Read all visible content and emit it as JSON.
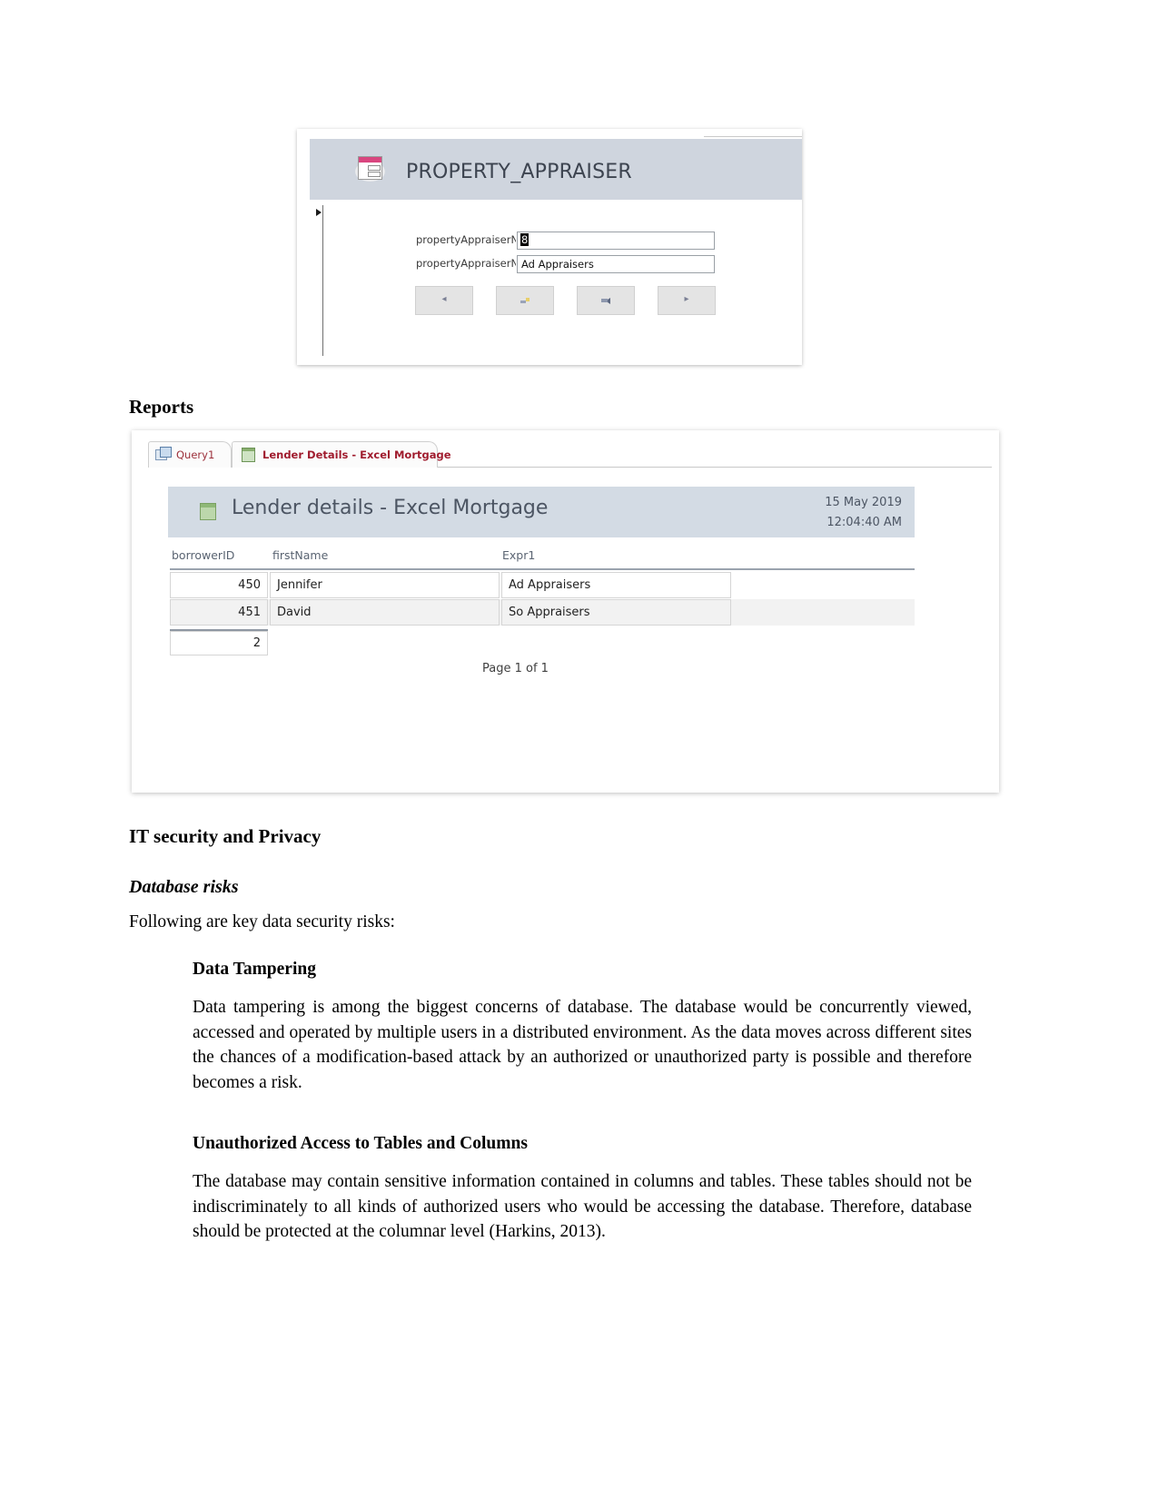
{
  "document": {
    "headings": {
      "reports": "Reports",
      "it_security": "IT security and Privacy",
      "database_risks": "Database risks",
      "data_tampering": "Data Tampering",
      "unauthorized_access": "Unauthorized Access to Tables and Columns"
    },
    "paragraphs": {
      "intro": "Following are key data security risks:",
      "data_tampering": "Data tampering is among the biggest concerns of database. The database would be concurrently viewed, accessed and operated by multiple users in a distributed environment. As the data moves across different sites the chances of a modification-based attack by an authorized or unauthorized party is possible and therefore becomes a risk.",
      "unauthorized_access": "The database may contain sensitive information contained in columns and tables. These tables should not be indiscriminately to all kinds of authorized users who would be accessing the database. Therefore, database should be protected at the columnar level (Harkins, 2013)."
    }
  },
  "form_screenshot": {
    "title": "PROPERTY_APPRAISER",
    "icon": "form-card-icon",
    "fields": [
      {
        "label": "propertyAppraiserN",
        "value": "8",
        "selected": true
      },
      {
        "label": "propertyAppraiserN",
        "value": "Ad Appraisers",
        "selected": false
      }
    ],
    "nav_buttons": [
      {
        "name": "previous-record-button",
        "glyph": "◂"
      },
      {
        "name": "add-record-button",
        "glyph": ""
      },
      {
        "name": "save-record-button",
        "glyph": ""
      },
      {
        "name": "next-record-button",
        "glyph": "▸"
      }
    ]
  },
  "report_screenshot": {
    "tabs": [
      {
        "label": "Query1",
        "icon": "query-icon",
        "active": false
      },
      {
        "label": "Lender Details - Excel Mortgage",
        "icon": "report-icon",
        "active": true
      }
    ],
    "header": {
      "title": "Lender details - Excel Mortgage",
      "icon": "report-icon",
      "date": "15 May 2019",
      "time": "12:04:40 AM"
    },
    "table": {
      "columns": [
        "borrowerID",
        "firstName",
        "Expr1"
      ],
      "rows": [
        {
          "borrowerID": "450",
          "firstName": "Jennifer",
          "expr1": "Ad Appraisers"
        },
        {
          "borrowerID": "451",
          "firstName": "David",
          "expr1": "So Appraisers"
        }
      ],
      "total": "2"
    },
    "page_footer": "Page 1 of 1"
  },
  "colors": {
    "form_header_bg": "#cfd5de",
    "report_header_bg": "#d3dbe4",
    "tab_active_text": "#a01c2e",
    "accent_pink": "#d9467f",
    "accent_green": "#8fb877"
  }
}
